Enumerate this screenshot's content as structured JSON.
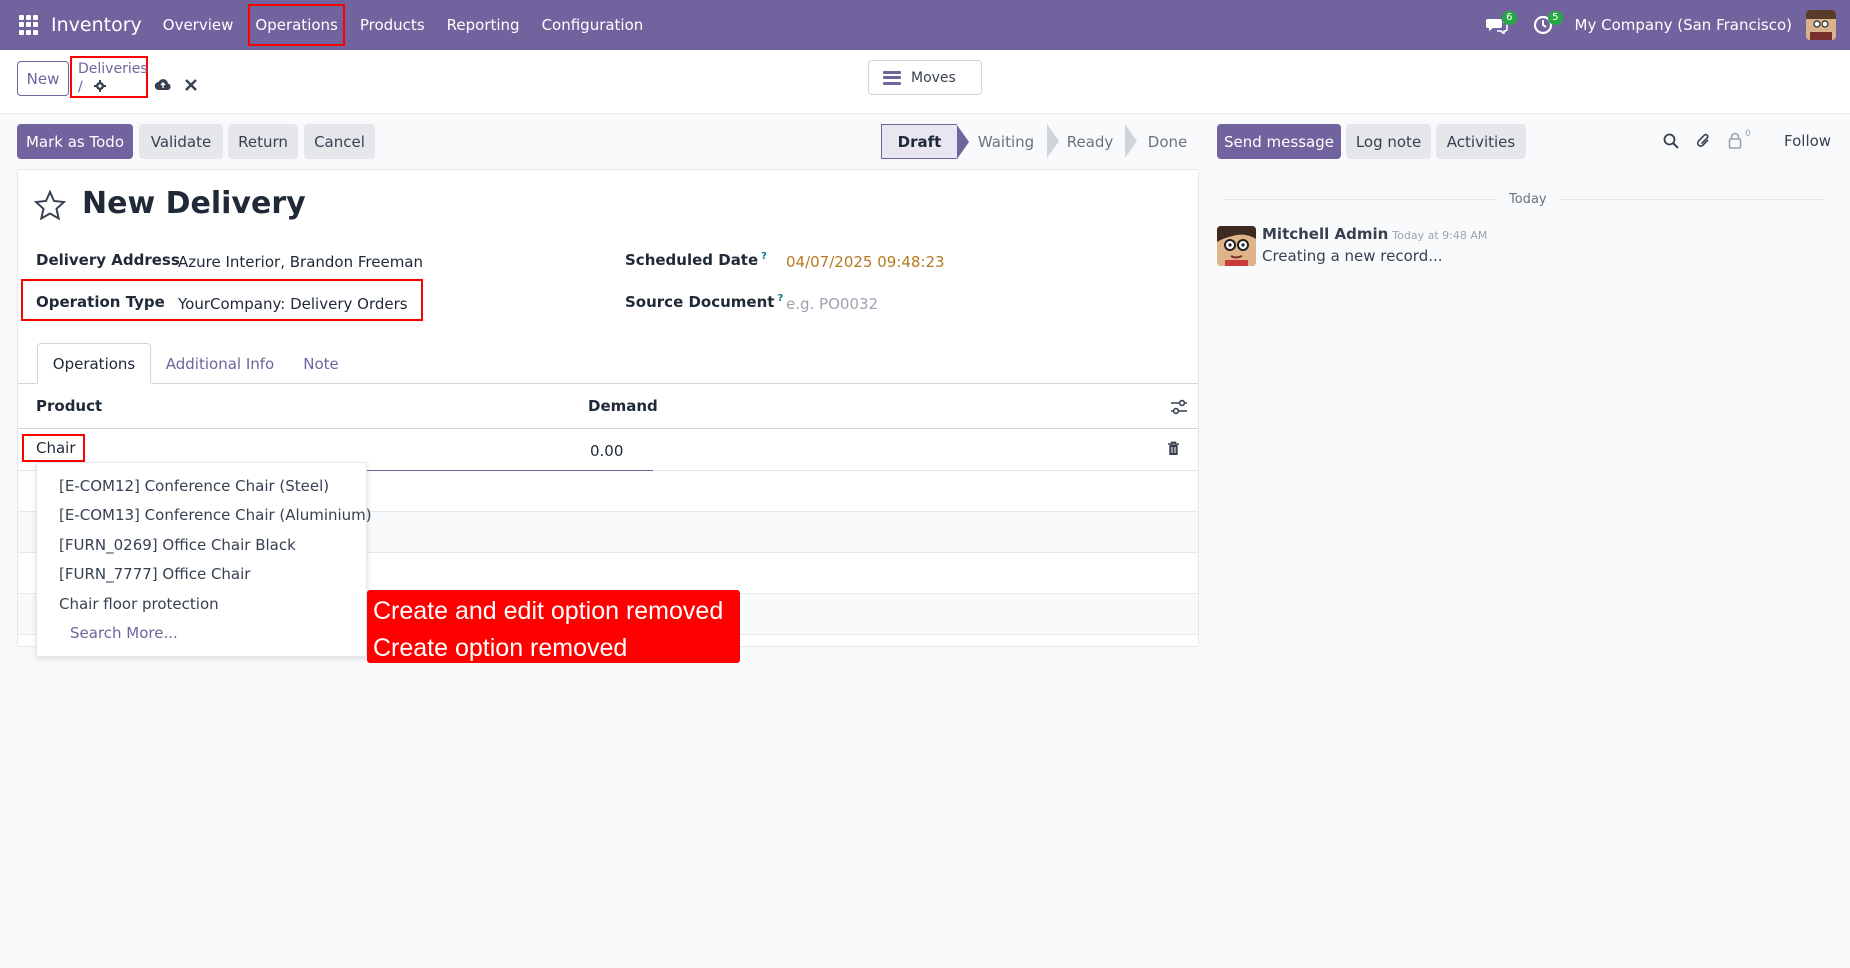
{
  "navbar": {
    "app_name": "Inventory",
    "menu": [
      "Overview",
      "Operations",
      "Products",
      "Reporting",
      "Configuration"
    ],
    "messages_count": "6",
    "activities_count": "5",
    "company": "My Company (San Francisco)"
  },
  "control_panel": {
    "new_label": "New",
    "breadcrumb_parent": "Deliveries",
    "breadcrumb_sep": "/",
    "moves_label": "Moves"
  },
  "actions": {
    "mark_todo": "Mark as Todo",
    "validate": "Validate",
    "return": "Return",
    "cancel": "Cancel"
  },
  "status": {
    "stages": [
      "Draft",
      "Waiting",
      "Ready",
      "Done"
    ],
    "active": "Draft"
  },
  "form": {
    "title": "New Delivery",
    "delivery_address_label": "Delivery Address",
    "delivery_address_value": "Azure Interior, Brandon Freeman",
    "operation_type_label": "Operation Type",
    "operation_type_value": "YourCompany: Delivery Orders",
    "scheduled_date_label": "Scheduled Date",
    "scheduled_date_value": "04/07/2025 09:48:23",
    "source_document_label": "Source Document",
    "source_document_placeholder": "e.g. PO0032",
    "help_mark": "?"
  },
  "tabs": [
    "Operations",
    "Additional Info",
    "Note"
  ],
  "table": {
    "col_product": "Product",
    "col_demand": "Demand",
    "row_product": "Chair",
    "row_demand": "0.00"
  },
  "dropdown": {
    "items": [
      "[E-COM12] Conference Chair (Steel)",
      "[E-COM13] Conference Chair (Aluminium)",
      "[FURN_0269] Office Chair Black",
      "[FURN_7777] Office Chair",
      "Chair floor protection"
    ],
    "search_more": "Search More..."
  },
  "annotation": {
    "line1": "Create and edit option removed",
    "line2": "Create option removed"
  },
  "chatter": {
    "send_message": "Send message",
    "log_note": "Log note",
    "activities": "Activities",
    "followers_count": "0",
    "follow": "Follow",
    "day_label": "Today",
    "author": "Mitchell Admin",
    "time": "Today at 9:48 AM",
    "message": "Creating a new record..."
  },
  "colors": {
    "brand": "#71639e",
    "annotation_red": "#ff0000",
    "date_text": "#b7791f"
  }
}
